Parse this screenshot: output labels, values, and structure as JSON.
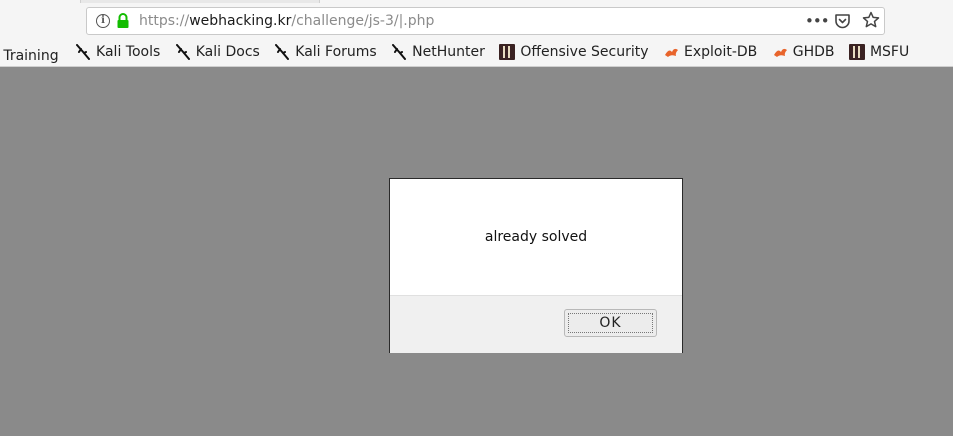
{
  "address_bar": {
    "protocol": "https://",
    "host": "webhacking.kr",
    "path": "/challenge/js-3/|.php"
  },
  "bookmarks": [
    {
      "label": "i Training",
      "icon": "none"
    },
    {
      "label": "Kali Tools",
      "icon": "kali-dragon-icon"
    },
    {
      "label": "Kali Docs",
      "icon": "kali-dragon-icon"
    },
    {
      "label": "Kali Forums",
      "icon": "kali-dragon-icon"
    },
    {
      "label": "NetHunter",
      "icon": "kali-dragon-icon"
    },
    {
      "label": "Offensive Security",
      "icon": "offsec-icon"
    },
    {
      "label": "Exploit-DB",
      "icon": "exploitdb-icon"
    },
    {
      "label": "GHDB",
      "icon": "exploitdb-icon"
    },
    {
      "label": "MSFU",
      "icon": "offsec-icon"
    }
  ],
  "dialog": {
    "message": "already solved",
    "ok_label": "OK"
  },
  "colors": {
    "lock": "#12bc00",
    "backdrop": "#8a8a8a",
    "exploit_icon": "#e8642b"
  }
}
